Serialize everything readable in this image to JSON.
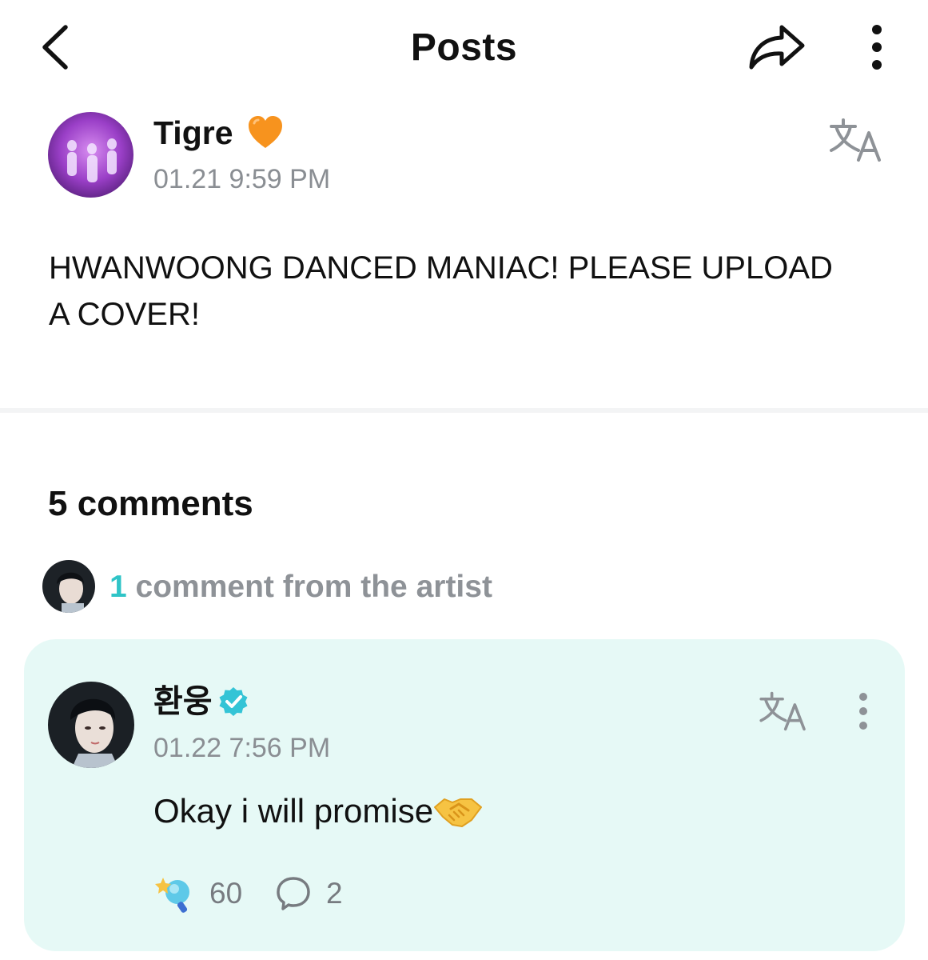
{
  "header": {
    "title": "Posts",
    "back_icon": "chevron-left-icon",
    "share_icon": "share-arrow-icon",
    "more_icon": "more-vertical-icon"
  },
  "post": {
    "author": "Tigre",
    "author_badge_icon": "orange-heart-icon",
    "timestamp": "01.21 9:59 PM",
    "body": "HWANWOONG DANCED MANIAC! PLEASE UPLOAD A COVER!",
    "translate_icon": "translate-icon"
  },
  "comments": {
    "count_label": "5 comments",
    "artist_summary": {
      "count": "1",
      "label": " comment from the artist"
    },
    "items": [
      {
        "author": "환웅",
        "verified_icon": "verified-badge-icon",
        "timestamp": "01.22 7:56 PM",
        "text": "Okay i will promise",
        "emoji_icon": "handshake-icon",
        "reaction_count": "60",
        "reply_count": "2"
      }
    ]
  },
  "colors": {
    "accent": "#2fc4c7",
    "card_background": "#e6f9f6",
    "muted_text": "#8a8e93",
    "heart": "#f7931e"
  }
}
